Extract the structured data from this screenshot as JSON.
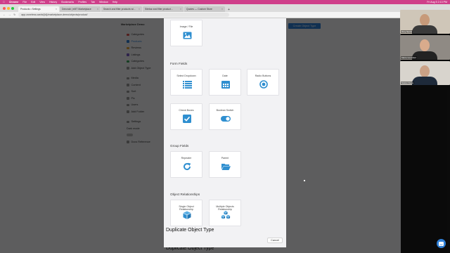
{
  "menubar": {
    "app": "Chrome",
    "items": [
      "File",
      "Edit",
      "View",
      "History",
      "Bookmarks",
      "Profiles",
      "Tab",
      "Window",
      "Help"
    ],
    "clock": "Fri Aug 5  2:13 PM"
  },
  "browser": {
    "tabs": [
      {
        "title": "Products • Settings"
      },
      {
        "title": "Dencrab | eMT Marketplace"
      },
      {
        "title": "Search and filter products wi..."
      },
      {
        "title": "Sitebar and filter product..."
      },
      {
        "title": "Quotes — Custom Store"
      }
    ],
    "url": "app.zoneless.cards/{id}/marketplace-demo/objects/product/"
  },
  "sidebar": {
    "workspace": "Marketplace Demo",
    "items": [
      "Categories",
      "Products",
      "Reviews",
      "Listings",
      "Categories",
      "Add Object Type"
    ],
    "secondary": [
      "Media",
      "Content",
      "Sort",
      "Pic",
      "Users",
      "Add Folder"
    ],
    "settings": "Settings",
    "dark_mode": "Dark mode",
    "help": "Docs Reference"
  },
  "header": {
    "create_button": "Create Object Type"
  },
  "modal": {
    "top_card": "Image / File",
    "sections": [
      {
        "title": "Form Fields",
        "cards": [
          {
            "label": "Select Dropdown",
            "icon": "list-icon"
          },
          {
            "label": "Date",
            "icon": "calendar-icon"
          },
          {
            "label": "Radio Buttons",
            "icon": "radio-icon"
          },
          {
            "label": "Check Boxes",
            "icon": "checkbox-icon"
          },
          {
            "label": "Boolean Switch",
            "icon": "toggle-icon"
          }
        ]
      },
      {
        "title": "Group Fields",
        "cards": [
          {
            "label": "Repeater",
            "icon": "repeat-icon"
          },
          {
            "label": "Parent",
            "icon": "folder-icon"
          }
        ]
      },
      {
        "title": "Object Relationships",
        "cards": [
          {
            "label": "Single Object Relationship",
            "icon": "cube-icon"
          },
          {
            "label": "Multiple Objects Relationship",
            "icon": "cubes-icon"
          }
        ]
      }
    ],
    "cancel": "Cancel"
  },
  "background_heading": "Duplicate Object Type",
  "video_call": {
    "participants": [
      "Tony Sarris",
      "Maria Gonzalez",
      "Stefan Klaus"
    ]
  },
  "colors": {
    "accent": "#2f7fd6",
    "menubar": "#cf3f8a"
  }
}
